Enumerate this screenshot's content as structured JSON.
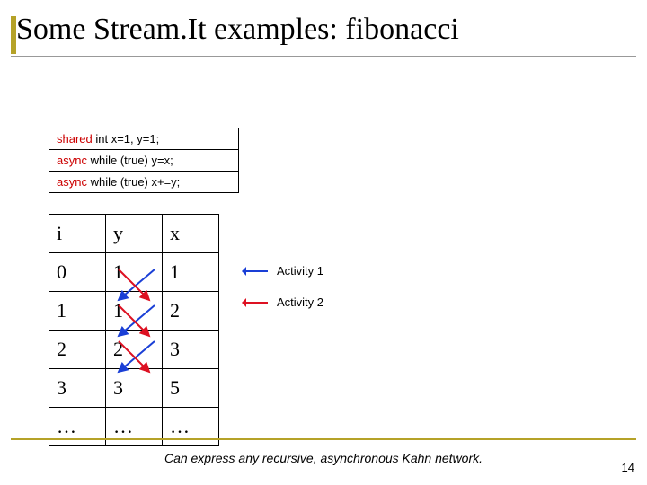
{
  "title": "Some Stream.It examples: fibonacci",
  "code": {
    "line1_prefix": "shared",
    "line1_rest": " int x=1, y=1;",
    "line2_prefix": "async",
    "line2_rest": " while (true) y=x;",
    "line3_prefix": "async",
    "line3_rest": " while (true)  x+=y;"
  },
  "table": {
    "header": [
      "i",
      "y",
      "x"
    ],
    "rows": [
      [
        "0",
        "1",
        "1"
      ],
      [
        "1",
        "1",
        "2"
      ],
      [
        "2",
        "2",
        "3"
      ],
      [
        "3",
        "3",
        "5"
      ],
      [
        "…",
        "…",
        "…"
      ]
    ]
  },
  "legend": {
    "activity1": "Activity 1",
    "activity2": "Activity 2"
  },
  "caption": "Can express any recursive, asynchronous Kahn network.",
  "page_number": "14"
}
